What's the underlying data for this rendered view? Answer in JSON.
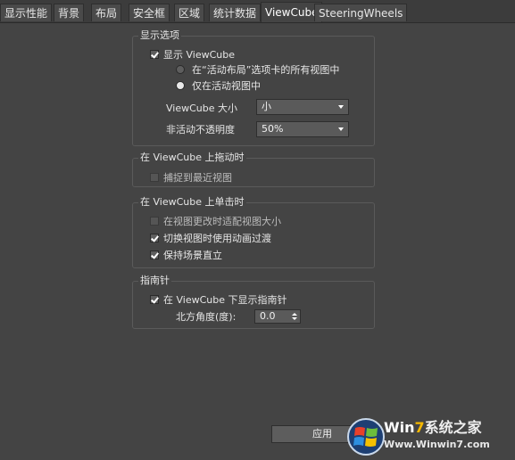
{
  "tabs": [
    {
      "label": "显示性能"
    },
    {
      "label": "背景"
    },
    {
      "label": "布局"
    },
    {
      "label": "安全框"
    },
    {
      "label": "区域"
    },
    {
      "label": "统计数据"
    },
    {
      "label": "ViewCube"
    },
    {
      "label": "SteeringWheels"
    }
  ],
  "active_tab": "ViewCube",
  "display_options": {
    "title": "显示选项",
    "show_viewcube": {
      "label": "显示 ViewCube",
      "checked": true
    },
    "radio_all": {
      "label": "在“活动布局”选项卡的所有视图中",
      "selected": false
    },
    "radio_active": {
      "label": "仅在活动视图中",
      "selected": true
    },
    "size_label": "ViewCube 大小",
    "size_value": "小",
    "opacity_label": "非活动不透明度",
    "opacity_value": "50%"
  },
  "drag_group": {
    "title": "在 ViewCube 上拖动时",
    "snap": {
      "label": "捕捉到最近视图",
      "checked": false
    }
  },
  "click_group": {
    "title": "在 ViewCube 上单击时",
    "fit": {
      "label": "在视图更改时适配视图大小",
      "checked": false
    },
    "animate": {
      "label": "切换视图时使用动画过渡",
      "checked": true
    },
    "upright": {
      "label": "保持场景直立",
      "checked": true
    }
  },
  "compass_group": {
    "title": "指南针",
    "show_compass": {
      "label": "在 ViewCube 下显示指南针",
      "checked": true
    },
    "north_label": "北方角度(度):",
    "north_value": "0.0"
  },
  "apply_label": "应用",
  "watermark": {
    "brand_a": "Win",
    "brand_b": "7",
    "brand_c": "系统之家",
    "url": "Www.Winwin7.com"
  }
}
